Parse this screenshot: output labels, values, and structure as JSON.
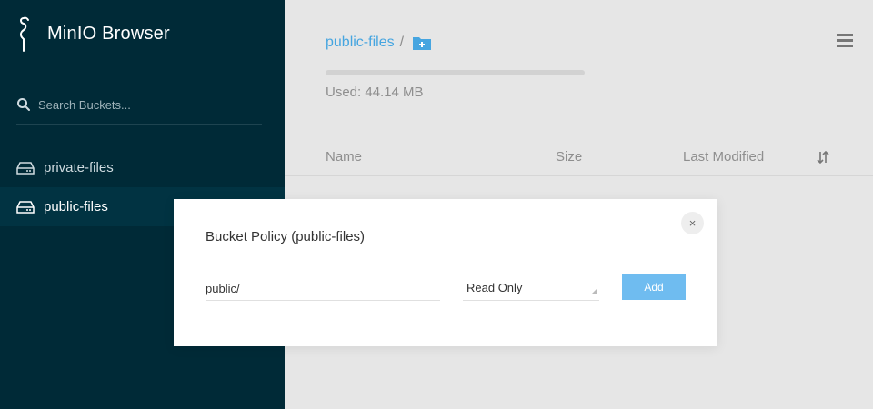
{
  "app": {
    "title": "MinIO Browser"
  },
  "sidebar": {
    "search_placeholder": "Search Buckets...",
    "buckets": [
      {
        "label": "private-files",
        "active": false
      },
      {
        "label": "public-files",
        "active": true
      }
    ]
  },
  "main": {
    "breadcrumb": {
      "bucket": "public-files",
      "separator": "/"
    },
    "usage": {
      "text": "Used: 44.14 MB",
      "fraction": 0
    },
    "columns": {
      "name": "Name",
      "size": "Size",
      "last_modified": "Last Modified"
    }
  },
  "modal": {
    "title": "Bucket Policy (public-files)",
    "close_label": "×",
    "prefix_value": "public/",
    "policy_selected": "Read Only",
    "add_label": "Add"
  },
  "colors": {
    "sidebar_bg": "#002a37",
    "accent": "#46a5e0",
    "add_button": "#6fbcf0"
  },
  "icons": {
    "logo": "flamingo-logo-icon",
    "search": "search-icon",
    "bucket": "drive-icon",
    "add_folder": "folder-plus-icon",
    "menu": "hamburger-menu-icon",
    "sort": "sort-icon",
    "close": "close-icon"
  }
}
